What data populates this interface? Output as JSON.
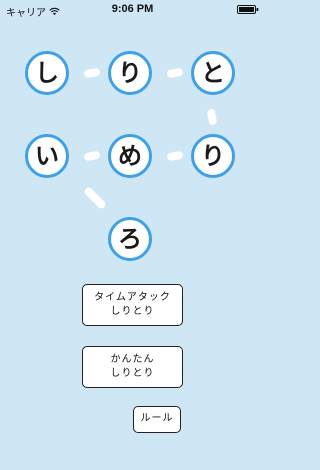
{
  "status_bar": {
    "carrier": "キャリア",
    "time": "9:06 PM"
  },
  "board": {
    "tiles": [
      "し",
      "り",
      "と",
      "い",
      "め",
      "り",
      "ろ"
    ]
  },
  "menu": {
    "time_attack_line1": "タイムアタック",
    "time_attack_line2": "しりとり",
    "easy_line1": "かんたん",
    "easy_line2": "しりとり",
    "rules_label": "ルール"
  }
}
